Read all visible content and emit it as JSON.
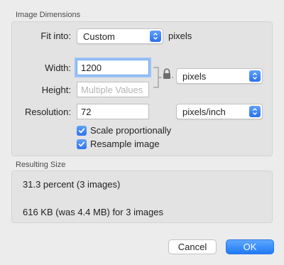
{
  "image_dimensions": {
    "section_label": "Image Dimensions",
    "fit_into": {
      "label": "Fit into:",
      "value": "Custom",
      "unit_label": "pixels"
    },
    "width": {
      "label": "Width:",
      "value": "1200"
    },
    "height": {
      "label": "Height:",
      "value": "",
      "placeholder": "Multiple Values"
    },
    "dimension_unit": {
      "value": "pixels"
    },
    "resolution": {
      "label": "Resolution:",
      "value": "72",
      "unit": "pixels/inch"
    },
    "scale_proportionally": {
      "label": "Scale proportionally",
      "checked": true
    },
    "resample_image": {
      "label": "Resample image",
      "checked": true
    }
  },
  "resulting_size": {
    "section_label": "Resulting Size",
    "percent_text": "31.3 percent (3 images)",
    "size_text": "616 KB (was 4.4 MB) for 3 images"
  },
  "buttons": {
    "cancel": "Cancel",
    "ok": "OK"
  },
  "colors": {
    "accent": "#2d6ff0",
    "focus_ring": "#9dc3f5"
  }
}
